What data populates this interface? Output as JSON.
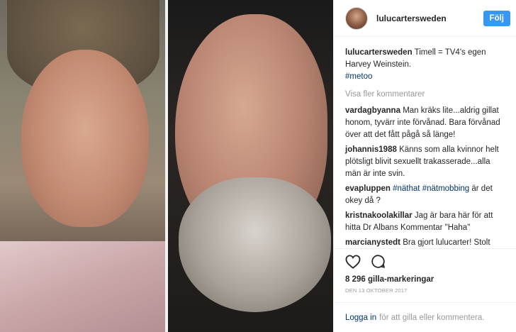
{
  "post": {
    "username": "lulucartersweden",
    "follow_label": "Följ",
    "caption_author": "lulucartersweden",
    "caption_text": "Timell = TV4's egen Harvey Weinstein.",
    "caption_tag": "#metoo",
    "view_more": "Visa fler kommentarer",
    "comments": [
      {
        "author": "vardagbyanna",
        "text": "Man kräks lite...aldrig gillat honom, tyvärr inte förvånad. Bara förvånad över att det fått pågå så länge!"
      },
      {
        "author": "johannis1988",
        "text": "Känns som alla kvinnor helt plötsligt blivit sexuellt trakasserade...alla män är inte svin."
      },
      {
        "author": "evapluppen",
        "tag1": "#näthat",
        "tag2": "#nätmobbing",
        "text": "är det okey då ?"
      },
      {
        "author": "kristnakoolakillar",
        "text": "Jag är bara här för att hitta Dr Albans Kommentar \"Haha\""
      },
      {
        "author": "marcianystedt",
        "text": "Bra gjort lulucarter! Stolt över dig som uppmuntrar många att stoppa med tystnaden... detta händer i Brasilien också... var som helst!💪🏻💄🌻"
      }
    ],
    "likes": "8 296 gilla-markeringar",
    "date": "DEN 13 OKTOBER 2017",
    "login_link": "Logga in",
    "login_text": "för att gilla eller kommentera.",
    "icons": {
      "like": "heart-icon",
      "comment": "comment-icon"
    }
  }
}
